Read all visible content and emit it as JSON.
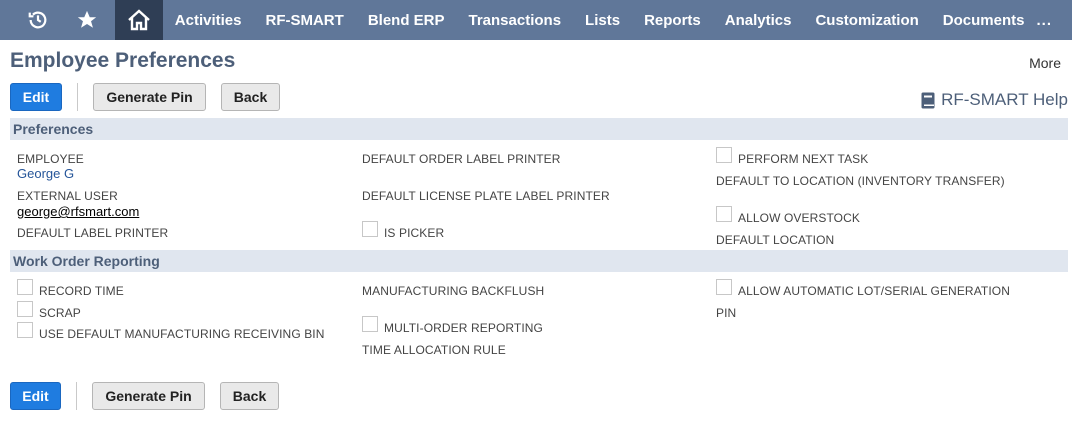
{
  "nav": {
    "items": [
      "Activities",
      "RF-SMART",
      "Blend ERP",
      "Transactions",
      "Lists",
      "Reports",
      "Analytics",
      "Customization",
      "Documents"
    ],
    "more": "...",
    "icons": [
      "recent-icon",
      "star-icon",
      "home-icon"
    ]
  },
  "page": {
    "title": "Employee Preferences",
    "more": "More",
    "help": "RF-SMART Help"
  },
  "buttons": {
    "edit": "Edit",
    "generate_pin": "Generate Pin",
    "back": "Back"
  },
  "sections": {
    "preferences": "Preferences",
    "work_order": "Work Order Reporting"
  },
  "preferences": {
    "employee_label": "EMPLOYEE",
    "employee_value": "George G",
    "external_user_label": "EXTERNAL USER",
    "external_user_value": "george@rfsmart.com",
    "default_label_printer": "DEFAULT LABEL PRINTER",
    "default_order_label_printer": "DEFAULT ORDER LABEL PRINTER",
    "default_license_plate_label_printer": "DEFAULT LICENSE PLATE LABEL PRINTER",
    "is_picker": "IS PICKER",
    "perform_next_task": "PERFORM NEXT TASK",
    "default_to_location": "DEFAULT TO LOCATION (INVENTORY TRANSFER)",
    "allow_overstock": "ALLOW OVERSTOCK",
    "default_location": "DEFAULT LOCATION"
  },
  "work_order": {
    "record_time": "RECORD TIME",
    "scrap": "SCRAP",
    "use_default_bin": "USE DEFAULT MANUFACTURING RECEIVING BIN",
    "manufacturing_backflush": "MANUFACTURING BACKFLUSH",
    "multi_order_reporting": "MULTI-ORDER REPORTING",
    "time_allocation_rule": "TIME ALLOCATION RULE",
    "allow_auto_lot": "ALLOW AUTOMATIC LOT/SERIAL GENERATION",
    "pin": "PIN"
  },
  "colors": {
    "nav_bg": "#607799",
    "home_bg": "#2f3e55",
    "primary": "#1f7ce0",
    "section_bg": "#e0e6ef",
    "title": "#4d5f79"
  }
}
